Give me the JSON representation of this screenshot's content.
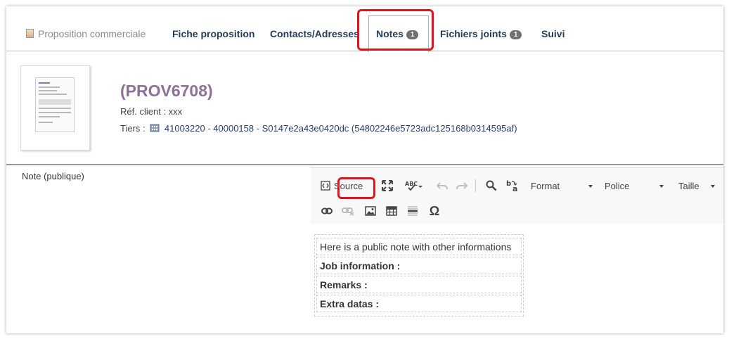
{
  "tabs": [
    {
      "label": "Proposition commerciale",
      "badge": ""
    },
    {
      "label": "Fiche proposition",
      "badge": ""
    },
    {
      "label": "Contacts/Adresses",
      "badge": ""
    },
    {
      "label": "Notes",
      "badge": "1"
    },
    {
      "label": "Fichiers joints",
      "badge": "1"
    },
    {
      "label": "Suivi",
      "badge": ""
    }
  ],
  "header": {
    "ref": "(PROV6708)",
    "ref_client": "Réf. client : xxx",
    "tiers_label": "Tiers :",
    "tiers_value": "41003220 - 40000158 - S0147e2a43e0420dc (54802246e5723adc125168b0314595af)"
  },
  "note": {
    "label": "Note (publique)"
  },
  "editor": {
    "source_label": "Source",
    "format_label": "Format",
    "police_label": "Police",
    "taille_label": "Taille",
    "rows": [
      "Here is a public note with other informations",
      "Job information :",
      "Remarks :",
      "Extra datas :"
    ]
  },
  "colors": {
    "accent": "#263c5c",
    "ref": "#8c6f9b",
    "highlight": "#e0141e"
  }
}
